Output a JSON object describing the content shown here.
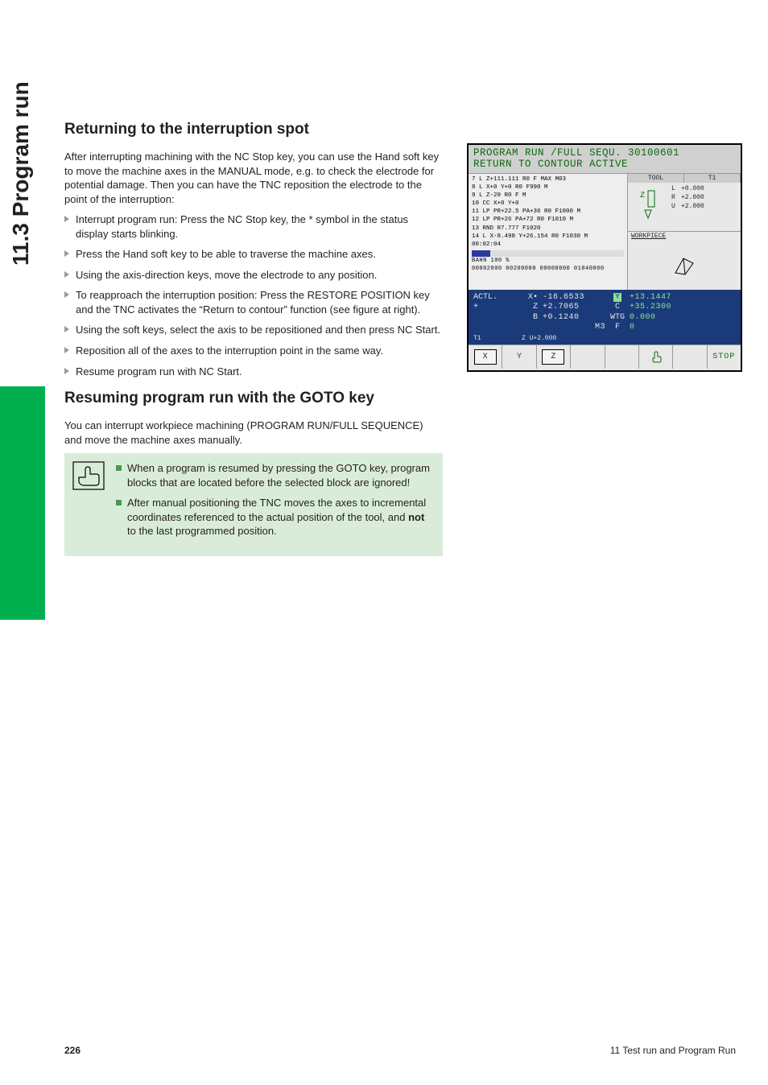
{
  "sidetab": {
    "label": "11.3 Program run"
  },
  "headings": {
    "h1": "Returning to the interruption spot",
    "h2": "Resuming program run with the GOTO key"
  },
  "para1": "After interrupting machining with the NC Stop key, you can use the Hand soft key to move the machine axes in the MANUAL mode, e.g. to check the electrode for potential damage. Then you can have the TNC reposition the electrode to the point of the interruption:",
  "list1": [
    "Interrupt program run: Press the NC Stop key, the * symbol in the status display starts blinking.",
    "Press the Hand soft key to be able to traverse the machine axes.",
    "Using the axis-direction keys, move the electrode to any position.",
    "To reapproach the interruption position: Press the RESTORE POSITION key and the TNC activates the “Return to contour” function (see figure at right).",
    "Using the soft keys, select the axis to be repositioned and then press NC Start.",
    "Reposition all of the axes to the interruption point in the same way.",
    "Resume program run with NC Start."
  ],
  "para2": "You can interrupt workpiece machining (PROGRAM RUN/FULL SEQUENCE) and move the machine axes manually.",
  "note": {
    "items": [
      {
        "pre": "When a program is resumed by pressing the GOTO key, program blocks that are located before the selected block are ignored!"
      },
      {
        "pre": "After manual positioning the TNC moves the axes to incremental coordinates referenced to the actual position of the tool, and ",
        "bold": "not",
        "post": " to the last programmed position."
      }
    ]
  },
  "screenshot": {
    "title_l1": "PROGRAM RUN /FULL SEQU. 30100601",
    "title_l2": "RETURN TO CONTOUR ACTIVE",
    "code": [
      "7   L Z+111.111 R0 F MAX M03",
      "8   L X+0 Y+0 R0 F990 M",
      "9   L Z-20 R0 F M",
      "10  CC X+0 Y+0",
      "11  LP PR+22.5 PA+36 R0 F1000 M",
      "12  LP PR+26 PA+72 R0 F1010 M",
      "13  RND R7.777 F1020",
      "14  L X-8.498 Y+26.154 R0 F1030 M",
      "        00:02:04"
    ],
    "progress_label": "BAHN 100 %",
    "progress_nums": "00002000 00200000 00000000 01040000",
    "tool_tab": "TOOL",
    "tool_id": "T1",
    "axis_z_label": "Z",
    "tool_vals": [
      {
        "k": "L",
        "v": "+0.000"
      },
      {
        "k": "R",
        "v": "+2.000"
      },
      {
        "k": "U",
        "v": "+2.000"
      }
    ],
    "wp_label": "WORKPIECE",
    "actl": {
      "label": "ACTL.",
      "rows": [
        {
          "a1": "X•",
          "v1": "-16.6533",
          "a2": "Y",
          "v2": "+13.1447",
          "hi": true
        },
        {
          "a1": "Z",
          "v1": "+2.7065",
          "a2": "C",
          "v2": "+35.2300"
        },
        {
          "a1": "B",
          "v1": "+0.1240",
          "a2": "WTG",
          "v2": "0.000"
        }
      ],
      "line4_left": "M3",
      "line4_f": "F",
      "line4_fv": "0"
    },
    "substrip": {
      "t1": "T1",
      "t2": "Z U+2.000"
    },
    "softkeys": {
      "x": "X",
      "y": "Y",
      "z": "Z",
      "stop": "STOP"
    }
  },
  "footer": {
    "page": "226",
    "right": "11 Test run and Program Run"
  }
}
